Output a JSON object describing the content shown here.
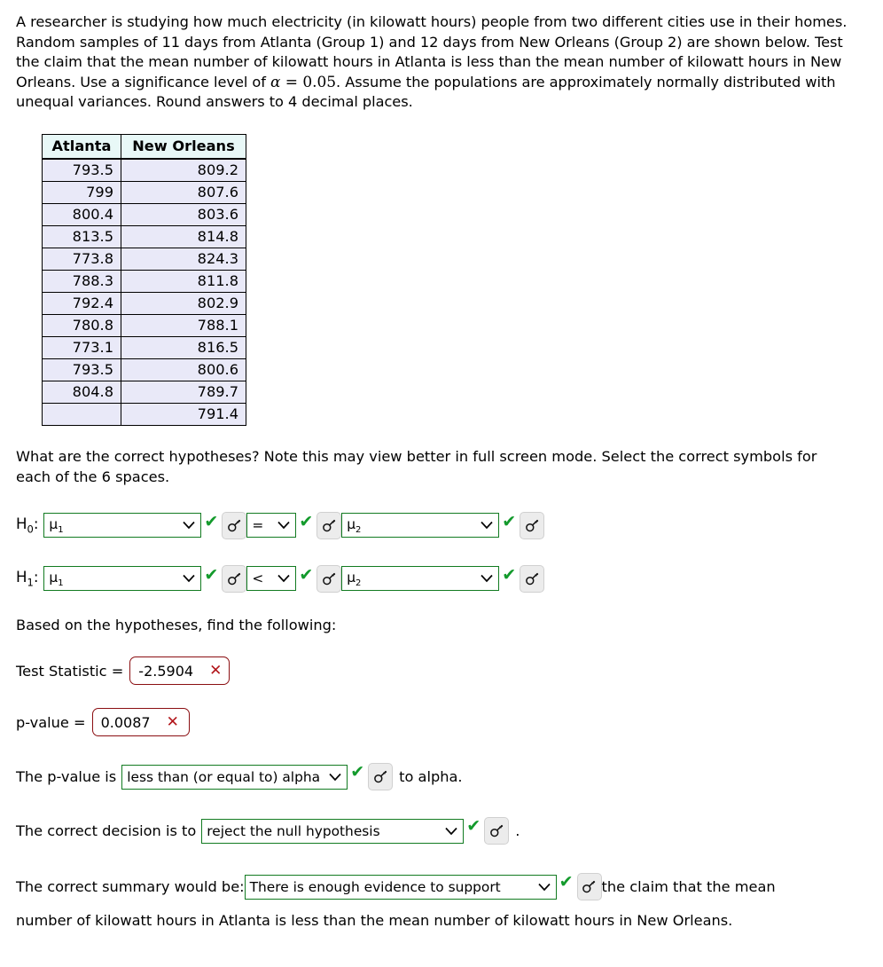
{
  "problem": {
    "intro_part1": "A researcher is studying how much electricity (in kilowatt hours) people from two different cities use in their homes. Random samples of 11 days from Atlanta (Group 1) and 12 days from New Orleans (Group 2) are shown below. Test the claim that the mean number of kilowatt hours in Atlanta is less than the mean number of kilowatt hours in New Orleans. Use a significance level of ",
    "alpha_symbol": "α",
    "equals_symbol": "=",
    "alpha_value": "0.05",
    "intro_part2": ". Assume the populations are approximately normally distributed with unequal variances. Round answers to 4 decimal places."
  },
  "data_table": {
    "headers": [
      "Atlanta",
      "New Orleans"
    ],
    "rows": [
      [
        "793.5",
        "809.2"
      ],
      [
        "799",
        "807.6"
      ],
      [
        "800.4",
        "803.6"
      ],
      [
        "813.5",
        "814.8"
      ],
      [
        "773.8",
        "824.3"
      ],
      [
        "788.3",
        "811.8"
      ],
      [
        "792.4",
        "802.9"
      ],
      [
        "780.8",
        "788.1"
      ],
      [
        "773.1",
        "816.5"
      ],
      [
        "793.5",
        "800.6"
      ],
      [
        "804.8",
        "789.7"
      ],
      [
        "",
        "791.4"
      ]
    ]
  },
  "hypotheses_prompt": "What are the correct hypotheses? Note this may view better in full screen mode. Select the correct symbols for each of the 6 spaces.",
  "hypotheses": {
    "h0": {
      "label_base": "H",
      "label_sub": "0",
      "label_colon": ":",
      "param1": "μ",
      "param1_sub": "1",
      "operator": "=",
      "param2": "μ",
      "param2_sub": "2"
    },
    "h1": {
      "label_base": "H",
      "label_sub": "1",
      "label_colon": ":",
      "param1": "μ",
      "param1_sub": "1",
      "operator": "<",
      "param2": "μ",
      "param2_sub": "2"
    }
  },
  "based_on_label": "Based on the hypotheses, find the following:",
  "answers": {
    "test_statistic_label": "Test Statistic =",
    "test_statistic_value": "-2.5904",
    "test_statistic_mark": "✕",
    "p_value_label": "p-value =",
    "p_value_value": "0.0087",
    "p_value_mark": "✕"
  },
  "pvalue_sentence": {
    "pre": "The p-value is",
    "selected": "less than (or equal to) alpha",
    "post": "to alpha."
  },
  "decision_sentence": {
    "pre": "The correct decision is to",
    "selected": "reject the null hypothesis",
    "post": "."
  },
  "summary_sentence": {
    "pre": "The correct summary would be:",
    "selected": "There is enough evidence to support",
    "post": "the claim that the mean",
    "line2": "number of kilowatt hours in Atlanta is less than the mean number of kilowatt hours in New Orleans."
  },
  "icons": {
    "check": "✔",
    "key": "key-icon",
    "chevron": "chevron-down-icon"
  },
  "colors": {
    "correct_green": "#127b21",
    "check_green": "#139a2c",
    "incorrect_red": "#8b0f12",
    "x_red": "#b2161b",
    "table_header_bg": "#e8f8f7",
    "table_cell_bg": "#e9e9f8"
  }
}
